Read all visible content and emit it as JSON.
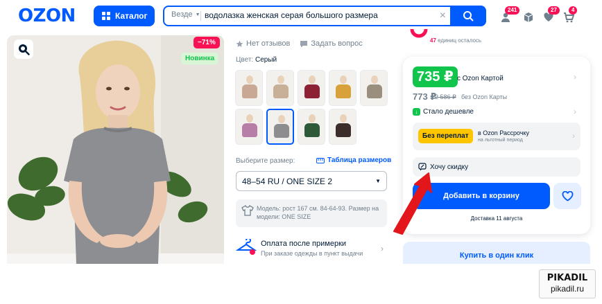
{
  "header": {
    "logo": "OZON",
    "catalog_label": "Каталог",
    "search": {
      "scope": "Везде",
      "query": "водолазка женская серая большого размера"
    },
    "badges": {
      "profile": "241",
      "favorites": "27",
      "cart": "4"
    }
  },
  "gallery": {
    "discount_badge": "−71%",
    "new_badge": "Новинка"
  },
  "product": {
    "no_reviews": "Нет отзывов",
    "ask_question": "Задать вопрос",
    "color_label": "Цвет:",
    "color_value": "Серый",
    "thumbnails": [
      {
        "color": "#c9a896"
      },
      {
        "color": "#c8b098"
      },
      {
        "color": "#8e2235"
      },
      {
        "color": "#d8a23a"
      },
      {
        "color": "#9a8f7f"
      },
      {
        "color": "#b77ea8"
      },
      {
        "color": "#8d8d8f",
        "selected": true
      },
      {
        "color": "#2f5a3a"
      },
      {
        "color": "#3a2d2a"
      }
    ],
    "size_label": "Выберите размер:",
    "size_table_link": "Таблица размеров",
    "size_value": "48–54 RU / ONE SIZE 2",
    "model_info": "Модель: рост 167 см. 84-64-93. Размер на модели: ONE SIZE",
    "payment_title": "Оплата после примерки",
    "payment_sub": "При заказе одежды в пункт выдачи"
  },
  "buybox": {
    "units_left_count": "47",
    "units_left_text": "единиц осталось",
    "card_price": "735 ₽",
    "card_price_caption": "с Ozon Картой",
    "regular_price": "773 ₽",
    "old_price": "2 586 ₽",
    "regular_caption": "без Ozon Карты",
    "cheaper_label": "Стало дешевле",
    "installment_badge": "Без переплат",
    "installment_title": "в Ozon Рассрочку",
    "installment_sub": "на льготный период",
    "want_discount": "Хочу скидку",
    "add_to_cart": "Добавить в корзину",
    "delivery": "Доставка 11 августа",
    "one_click": "Купить в один клик"
  },
  "watermark": {
    "title": "PIKADIL",
    "url": "pikadil.ru"
  },
  "colors": {
    "brand": "#005bff",
    "sale": "#f91155",
    "green": "#10c44c",
    "arrow": "#e3161b"
  }
}
